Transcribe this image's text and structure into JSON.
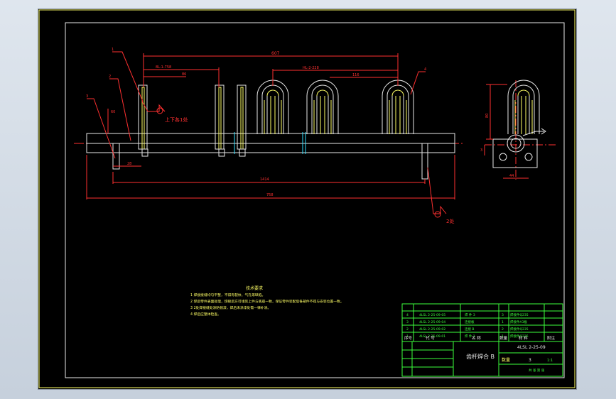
{
  "drawing": {
    "dimensions": {
      "overall": "607",
      "d1": "8L-1-758",
      "d2": "86",
      "d3": "HL-2-228",
      "d4": "116",
      "d5": "60",
      "d6": "28",
      "d7": "1414",
      "d8": "758",
      "side_height": "80",
      "side_width": "44",
      "side_small": "3"
    },
    "balloons": [
      "1",
      "2",
      "3",
      "4"
    ],
    "annotations": {
      "weld_up_down": "上下各1处",
      "weld_two": "2处"
    }
  },
  "notes": {
    "title": "技术要求",
    "lines": [
      "1 焊接接缝均匀平整，不得有裂纹、气孔等缺陷。",
      "2 焊后零件表面处理，焊接后方可组装上件与底座一致，保证零件装配后各部件不得与安装位置一致。",
      "3 2处焊接缝处涂防锈漆，焊后未涂漆处需一律补涂。",
      "4 焊后应整体检查。"
    ]
  },
  "bom": {
    "rows": [
      {
        "no": "4",
        "code": "4LSL 2-25-09-05",
        "name": "焊 件 3",
        "qty": "3",
        "material": "焊接件Q235",
        "note": ""
      },
      {
        "no": "3",
        "code": "4LSL 2-25-09-04",
        "name": "连接板",
        "qty": "1",
        "material": "焊接件A3板",
        "note": ""
      },
      {
        "no": "2",
        "code": "4LSL 2-25-09-02",
        "name": "连接 B",
        "qty": "2",
        "material": "焊接件Q235",
        "note": ""
      },
      {
        "no": "1",
        "code": "4LSL 2-25-09-01",
        "name": "焊 件 1",
        "qty": "1",
        "material": "焊接件Q235",
        "note": ""
      }
    ],
    "headers": {
      "no": "序号",
      "code": "代    号",
      "name": "名  称",
      "qty": "数量",
      "material": "材  料",
      "note": "附注"
    }
  },
  "title_block": {
    "drawing_no": "4LSL 2-25-09",
    "part_name": "齿杆焊合 B",
    "quantity_label": "数量",
    "quantity": "3",
    "scale": "1:1",
    "sheet": "共 张 第 张"
  }
}
